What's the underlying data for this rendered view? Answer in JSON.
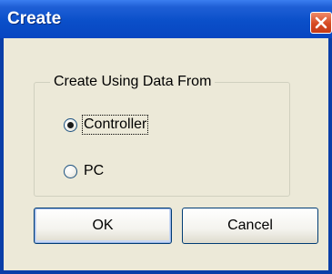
{
  "window": {
    "title": "Create",
    "close_icon": "close-icon"
  },
  "group": {
    "legend": "Create Using Data From",
    "options": [
      {
        "label": "Controller",
        "checked": true,
        "focused": true
      },
      {
        "label": "PC",
        "checked": false,
        "focused": false
      }
    ]
  },
  "buttons": {
    "ok_label": "OK",
    "cancel_label": "Cancel"
  },
  "colors": {
    "titlebar": "#0a4fc9",
    "client_background": "#ece9d8",
    "close_button": "#d64a22"
  }
}
